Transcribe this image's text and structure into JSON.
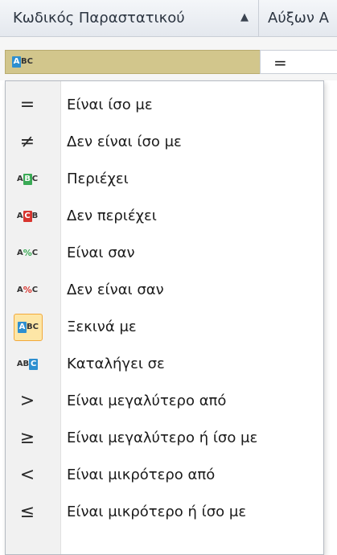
{
  "header": {
    "column1_title": "Κωδικός Παραστατικού",
    "column1_sort_indicator": "▲",
    "column2_title": "Αύξων Α"
  },
  "filter_row": {
    "selected_condition_icon": "starts-with-icon",
    "column2_operator": "="
  },
  "menu": {
    "selected_index": 6,
    "items": [
      {
        "label": "Είναι ίσο με",
        "icon": "equals-icon"
      },
      {
        "label": "Δεν είναι ίσο με",
        "icon": "not-equals-icon"
      },
      {
        "label": "Περιέχει",
        "icon": "contains-icon"
      },
      {
        "label": "Δεν περιέχει",
        "icon": "not-contains-icon"
      },
      {
        "label": "Είναι σαν",
        "icon": "like-icon"
      },
      {
        "label": "Δεν είναι σαν",
        "icon": "not-like-icon"
      },
      {
        "label": "Ξεκινά με",
        "icon": "starts-with-icon"
      },
      {
        "label": "Καταλήγει σε",
        "icon": "ends-with-icon"
      },
      {
        "label": "Είναι μεγαλύτερο από",
        "icon": "greater-than-icon"
      },
      {
        "label": "Είναι μεγαλύτερο ή ίσο με",
        "icon": "greater-or-equal-icon"
      },
      {
        "label": "Είναι μικρότερο από",
        "icon": "less-than-icon"
      },
      {
        "label": "Είναι μικρότερο ή ίσο με",
        "icon": "less-or-equal-icon"
      }
    ]
  },
  "colors": {
    "selected_cell": "#d2c68c",
    "active_item_bg": "#fde6a6",
    "active_item_border": "#f2a93b",
    "icon_blue": "#2d8fd0",
    "icon_green": "#3aaa55",
    "icon_red": "#d8352f"
  }
}
